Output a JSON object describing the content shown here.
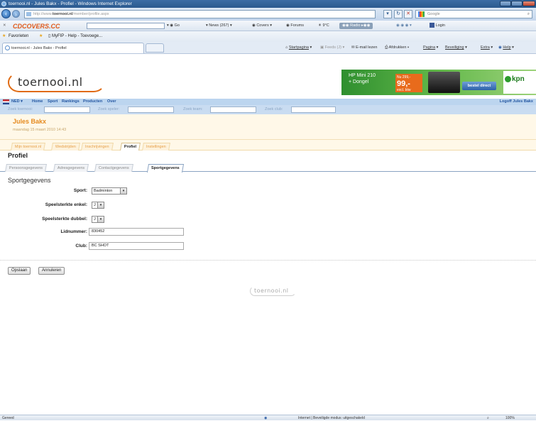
{
  "window": {
    "title": "toernooi.nl - Jules Bakx - Profiel - Windows Internet Explorer"
  },
  "browser": {
    "address": {
      "prefix": "http://www.",
      "domain": "toernooi.nl",
      "path": "/member/profile.aspx"
    },
    "search_placeholder": "Google",
    "toolbar": {
      "brand": "CDCOVERS.CC",
      "go": "Go",
      "news": "News (267)",
      "covers": "Covers",
      "forums": "Forums",
      "temp": "9°C",
      "radio": "Radio",
      "login": "Login"
    },
    "favorites": {
      "label": "Favorieten",
      "item1": "MyFIP - Help - Toevoege..."
    },
    "commands": {
      "startpagina": "Startpagina",
      "feeds": "Feeds (J)",
      "email": "E-mail lezen",
      "print": "Afdrukken",
      "pagina": "Pagina",
      "beveiliging": "Beveiliging",
      "extra": "Extra",
      "help": "Help"
    },
    "tab_title": "toernooi.nl - Jules Bakx - Profiel"
  },
  "site": {
    "logo": "toernooi.nl",
    "ad": {
      "line1": "HP Mini 210",
      "line2": "+ Dongel",
      "price_small": "Nu 299,-",
      "price": "99,-",
      "price_note": "excl. btw",
      "cta": "bestel direct",
      "brand": "kpn"
    },
    "nav": {
      "lang": "NED",
      "items": [
        "Home",
        "Sport",
        "Rankings",
        "Producten",
        "Over"
      ],
      "logoff": "Logoff  Jules Bakx"
    },
    "search": {
      "toernooi": "Zoek toernooi:",
      "speler": "Zoek speler:",
      "team": "Zoek team:",
      "club": "Zoek club:"
    },
    "user": {
      "name": "Jules Bakx",
      "date": "maandag 15 maart 2010 14:43"
    },
    "subnav": [
      "Mijn toernooi.nl",
      "Wedstrijden",
      "Inschrijvingen",
      "Profiel",
      "Instellingen"
    ],
    "subnav_active": 3
  },
  "profile": {
    "title": "Profiel",
    "tabs": [
      "Persoonsgegevens",
      "Adresgegevens",
      "Contactgegevens",
      "Sportgegevens"
    ],
    "active_tab": 3,
    "section": "Sportgegevens",
    "fields": {
      "sport": {
        "label": "Sport:",
        "value": "Badminton"
      },
      "enkel": {
        "label": "Speelsterkte enkel:",
        "value": "J"
      },
      "dubbel": {
        "label": "Speelsterkte dubbel:",
        "value": "J"
      },
      "lidnummer": {
        "label": "Lidnummer:",
        "value": "830452"
      },
      "club": {
        "label": "Club:",
        "value": "BC SHOT"
      }
    },
    "buttons": {
      "save": "Opslaan",
      "cancel": "Annuleren"
    }
  },
  "footer": {
    "logo": "toernooi.nl"
  },
  "status": {
    "left": "Gereed",
    "zone": "Internet | Beveiligde modus: uitgeschakeld",
    "zoom": "100%"
  }
}
